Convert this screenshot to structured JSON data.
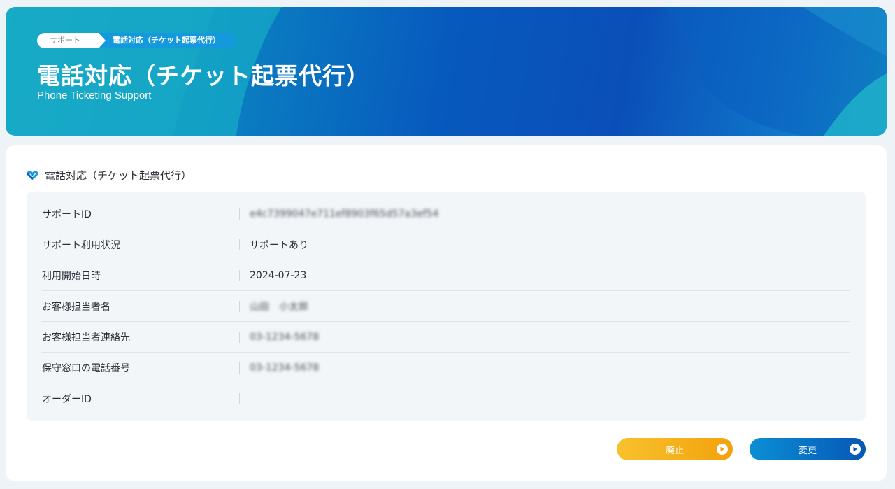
{
  "header": {
    "breadcrumb": {
      "home_label": "サポート",
      "current_label": "電話対応（チケット起票代行）"
    },
    "title": "電話対応（チケット起票代行）",
    "subtitle": "Phone Ticketing Support"
  },
  "section": {
    "icon": "support-heart-icon",
    "title": "電話対応（チケット起票代行）"
  },
  "details": {
    "rows": [
      {
        "label": "サポートID",
        "value": "e4c7399047e711ef8903f65d57a3ef54"
      },
      {
        "label": "サポート利用状況",
        "value": "サポートあり"
      },
      {
        "label": "利用開始日時",
        "value": "2024-07-23"
      },
      {
        "label": "お客様担当者名",
        "value": "山田　小太郎"
      },
      {
        "label": "お客様担当者連絡先",
        "value": "03-1234-5678"
      },
      {
        "label": "保守窓口の電話番号",
        "value": "03-1234-5678"
      },
      {
        "label": "オーダーID",
        "value": ""
      }
    ]
  },
  "actions": {
    "abolish_label": "廃止",
    "change_label": "変更",
    "button_icon": "play-circle-icon"
  },
  "colors": {
    "accent_blue": "#0759bd",
    "accent_cyan": "#12a7c4",
    "abolish_yellow": "#f2a20c",
    "table_bg": "#f3f6f9"
  }
}
